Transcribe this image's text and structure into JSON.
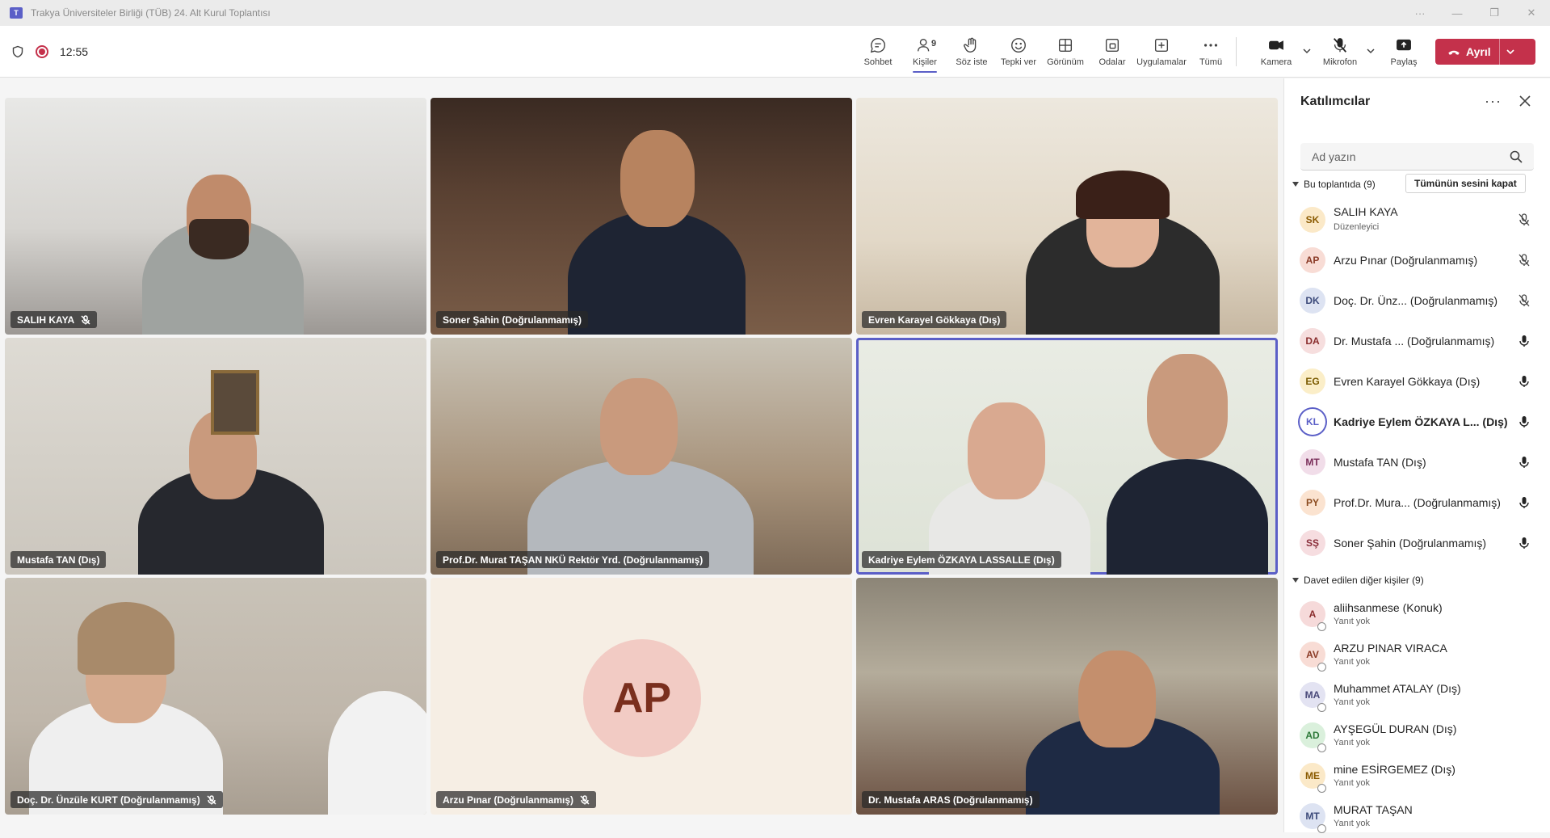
{
  "window": {
    "title": "Trakya Üniversiteler Birliği (TÜB) 24. Alt Kurul Toplantısı"
  },
  "meeting": {
    "elapsed": "12:55"
  },
  "toolbar": {
    "chat": "Sohbet",
    "people": "Kişiler",
    "people_count": "9",
    "raise_hand": "Söz iste",
    "react": "Tepki ver",
    "view": "Görünüm",
    "rooms": "Odalar",
    "apps": "Uygulamalar",
    "more": "Tümü",
    "camera": "Kamera",
    "mic": "Mikrofon",
    "share": "Paylaş",
    "leave": "Ayrıl"
  },
  "tiles": [
    {
      "name": "SALIH KAYA"
    },
    {
      "name": "Soner Şahin (Doğrulanmamış)"
    },
    {
      "name": "Evren Karayel Gökkaya (Dış)"
    },
    {
      "name": "Mustafa TAN (Dış)"
    },
    {
      "name": "Prof.Dr. Murat TAŞAN NKÜ Rektör Yrd. (Doğrulanmamış)"
    },
    {
      "name": "Kadriye Eylem ÖZKAYA LASSALLE (Dış)"
    },
    {
      "name": "Doç. Dr. Ünzüle KURT (Doğrulanmamış)"
    },
    {
      "name": "Arzu Pınar (Doğrulanmamış)",
      "initials": "AP"
    },
    {
      "name": "Dr. Mustafa ARAS (Doğrulanmamış)"
    }
  ],
  "panel": {
    "title": "Katılımcılar",
    "search_placeholder": "Ad yazın",
    "in_meeting_label": "Bu toplantıda (9)",
    "mute_all": "Tümünün sesini kapat",
    "invited_label": "Davet edilen diğer kişiler (9)",
    "participants": [
      {
        "initials": "SK",
        "name": "SALIH KAYA",
        "role": "Düzenleyici",
        "color": "#fbe9c8",
        "fg": "#8a5a00"
      },
      {
        "initials": "AP",
        "name": "Arzu Pınar (Doğrulanmamış)",
        "color": "#f8dcd5",
        "fg": "#8a3a26"
      },
      {
        "initials": "DK",
        "name": "Doç. Dr. Ünz...  (Doğrulanmamış)",
        "color": "#dde3f2",
        "fg": "#3c4a7a"
      },
      {
        "initials": "DA",
        "name": "Dr. Mustafa ...  (Doğrulanmamış)",
        "color": "#f6dede",
        "fg": "#8a2e2e"
      },
      {
        "initials": "EG",
        "name": "Evren Karayel Gökkaya (Dış)",
        "color": "#fbeec8",
        "fg": "#7a5a00"
      },
      {
        "initials": "KL",
        "name": "Kadriye Eylem ÖZKAYA L... (Dış)",
        "color": "#ffffff",
        "fg": "#5b5fc7"
      },
      {
        "initials": "MT",
        "name": "Mustafa TAN (Dış)",
        "color": "#f1dde9",
        "fg": "#7a2e5a"
      },
      {
        "initials": "PY",
        "name": "Prof.Dr. Mura... (Doğrulanmamış)",
        "color": "#fbe3d0",
        "fg": "#8a4a1e"
      },
      {
        "initials": "SŞ",
        "name": "Soner Şahin (Doğrulanmamış)",
        "color": "#f6dde0",
        "fg": "#8a2e3a"
      }
    ],
    "invited": [
      {
        "initials": "A",
        "name": "aliihsanmese (Konuk)",
        "status": "Yanıt yok",
        "color": "#f6dada",
        "fg": "#8a2e2e"
      },
      {
        "initials": "AV",
        "name": "ARZU PINAR VIRACA",
        "status": "Yanıt yok",
        "color": "#f8dcd5",
        "fg": "#8a3a26"
      },
      {
        "initials": "MA",
        "name": "Muhammet ATALAY (Dış)",
        "status": "Yanıt yok",
        "color": "#e3e3f2",
        "fg": "#4a4a7a"
      },
      {
        "initials": "AD",
        "name": "AYŞEGÜL DURAN (Dış)",
        "status": "Yanıt yok",
        "color": "#daf0dc",
        "fg": "#2e7a3a"
      },
      {
        "initials": "ME",
        "name": "mine ESİRGEMEZ (Dış)",
        "status": "Yanıt yok",
        "color": "#fbe9c8",
        "fg": "#8a5a00"
      },
      {
        "initials": "MT",
        "name": "MURAT TAŞAN",
        "status": "Yanıt yok",
        "color": "#dde3f2",
        "fg": "#3c4a7a"
      }
    ]
  }
}
